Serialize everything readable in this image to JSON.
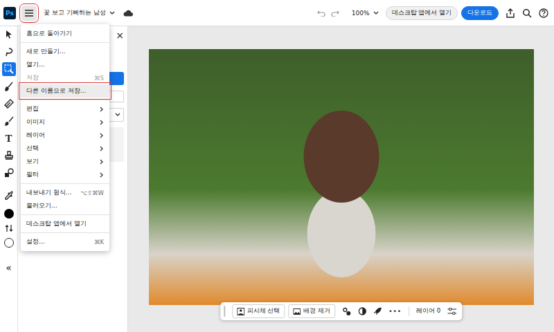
{
  "app": {
    "logo": "Ps"
  },
  "document": {
    "title": "꽃 보고 기뻐하는 남성"
  },
  "zoom": "100%",
  "header_buttons": [
    {
      "label": "데스크탑 앱에서 열기",
      "primary": false
    },
    {
      "label": "다운로드",
      "primary": true
    }
  ],
  "menu_button": {
    "open": true,
    "highlighted": true
  },
  "tools": [
    {
      "name": "move",
      "kind": "icon",
      "glyph": "",
      "selected": false
    },
    {
      "name": "lasso",
      "kind": "icon",
      "glyph": "",
      "selected": false
    },
    {
      "name": "quick-select",
      "kind": "icon",
      "glyph": "",
      "selected": true
    },
    {
      "name": "adjust-brush",
      "kind": "icon",
      "glyph": "",
      "selected": false
    },
    {
      "name": "heal",
      "kind": "icon",
      "glyph": "",
      "selected": false
    },
    {
      "name": "brush",
      "kind": "icon",
      "glyph": "",
      "selected": false
    },
    {
      "name": "type",
      "kind": "glyph",
      "glyph": "T",
      "selected": false
    },
    {
      "name": "stamp",
      "kind": "icon",
      "glyph": "",
      "selected": false
    },
    {
      "name": "shapes",
      "kind": "icon",
      "glyph": "",
      "selected": false
    },
    {
      "name": "eyedropper",
      "kind": "icon",
      "glyph": "",
      "selected": false
    }
  ],
  "swatches": [
    {
      "name": "foreground",
      "color": "#000000"
    },
    {
      "name": "background",
      "color": "#ffffff"
    }
  ],
  "collapse": "«",
  "panel": {
    "close": "×"
  },
  "menu": {
    "items": [
      {
        "label": "홈으로 돌아가기",
        "shortcut": "",
        "submenu": false,
        "disabled": false,
        "highlighted": false,
        "separator_after": true
      },
      {
        "label": "새로 만들기...",
        "shortcut": "",
        "submenu": false,
        "disabled": false,
        "highlighted": false,
        "separator_after": false
      },
      {
        "label": "열기...",
        "shortcut": "",
        "submenu": false,
        "disabled": false,
        "highlighted": false,
        "separator_after": false
      },
      {
        "label": "저장",
        "shortcut": "⌘S",
        "submenu": false,
        "disabled": true,
        "highlighted": false,
        "separator_after": false
      },
      {
        "label": "다른 이름으로 저장...",
        "shortcut": "",
        "submenu": false,
        "disabled": false,
        "highlighted": true,
        "separator_after": true
      },
      {
        "label": "편집",
        "shortcut": "",
        "submenu": true,
        "disabled": false,
        "highlighted": false,
        "separator_after": false
      },
      {
        "label": "이미지",
        "shortcut": "",
        "submenu": true,
        "disabled": false,
        "highlighted": false,
        "separator_after": false
      },
      {
        "label": "레이어",
        "shortcut": "",
        "submenu": true,
        "disabled": false,
        "highlighted": false,
        "separator_after": false
      },
      {
        "label": "선택",
        "shortcut": "",
        "submenu": true,
        "disabled": false,
        "highlighted": false,
        "separator_after": false
      },
      {
        "label": "보기",
        "shortcut": "",
        "submenu": true,
        "disabled": false,
        "highlighted": false,
        "separator_after": false
      },
      {
        "label": "필터",
        "shortcut": "",
        "submenu": true,
        "disabled": false,
        "highlighted": false,
        "separator_after": true
      },
      {
        "label": "내보내기 형식...",
        "shortcut": "⌥⇧⌘W",
        "submenu": false,
        "disabled": false,
        "highlighted": false,
        "separator_after": false
      },
      {
        "label": "불러오기...",
        "shortcut": "",
        "submenu": false,
        "disabled": false,
        "highlighted": false,
        "separator_after": true
      },
      {
        "label": "데스크탑 앱에서 열기",
        "shortcut": "",
        "submenu": false,
        "disabled": false,
        "highlighted": false,
        "separator_after": true
      },
      {
        "label": "설정...",
        "shortcut": "⌘K",
        "submenu": false,
        "disabled": false,
        "highlighted": false,
        "separator_after": false
      }
    ]
  },
  "bottom_bar": {
    "buttons": [
      {
        "label": "피사체 선택"
      },
      {
        "label": "배경 제거"
      }
    ],
    "more": "•••",
    "layer": "레이어 0"
  }
}
